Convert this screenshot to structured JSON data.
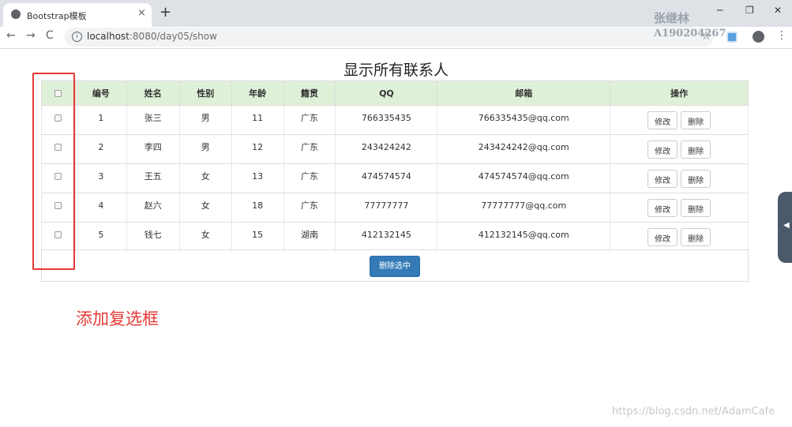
{
  "browser": {
    "tab_title": "Bootstrap模板",
    "tab_close": "×",
    "new_tab": "+",
    "minimize": "─",
    "restore": "❐",
    "close": "✕",
    "back": "←",
    "forward": "→",
    "reload": "C",
    "info": "i",
    "url_host": "localhost",
    "url_rest": ":8080/day05/show",
    "star": "☆",
    "menu": "⋮"
  },
  "watermark": {
    "name": "张继林",
    "id": "A190204267"
  },
  "page": {
    "title": "显示所有联系人",
    "columns": [
      "编号",
      "姓名",
      "性别",
      "年龄",
      "籍贯",
      "QQ",
      "邮箱",
      "操作"
    ],
    "rows": [
      {
        "id": "1",
        "name": "张三",
        "gender": "男",
        "age": "11",
        "hometown": "广东",
        "qq": "766335435",
        "email": "766335435@qq.com"
      },
      {
        "id": "2",
        "name": "李四",
        "gender": "男",
        "age": "12",
        "hometown": "广东",
        "qq": "243424242",
        "email": "243424242@qq.com"
      },
      {
        "id": "3",
        "name": "王五",
        "gender": "女",
        "age": "13",
        "hometown": "广东",
        "qq": "474574574",
        "email": "474574574@qq.com"
      },
      {
        "id": "4",
        "name": "赵六",
        "gender": "女",
        "age": "18",
        "hometown": "广东",
        "qq": "77777777",
        "email": "77777777@qq.com"
      },
      {
        "id": "5",
        "name": "钱七",
        "gender": "女",
        "age": "15",
        "hometown": "湖南",
        "qq": "412132145",
        "email": "412132145@qq.com"
      }
    ],
    "edit_label": "修改",
    "delete_label": "删除",
    "delete_selected_label": "删除选中",
    "annotation": "添加复选框"
  },
  "side_arrow": "◀",
  "footer_watermark": "https://blog.csdn.net/AdamCafe",
  "colors": {
    "header_bg": "#dff0d8",
    "primary": "#337ab7",
    "annotation": "#e53935"
  }
}
